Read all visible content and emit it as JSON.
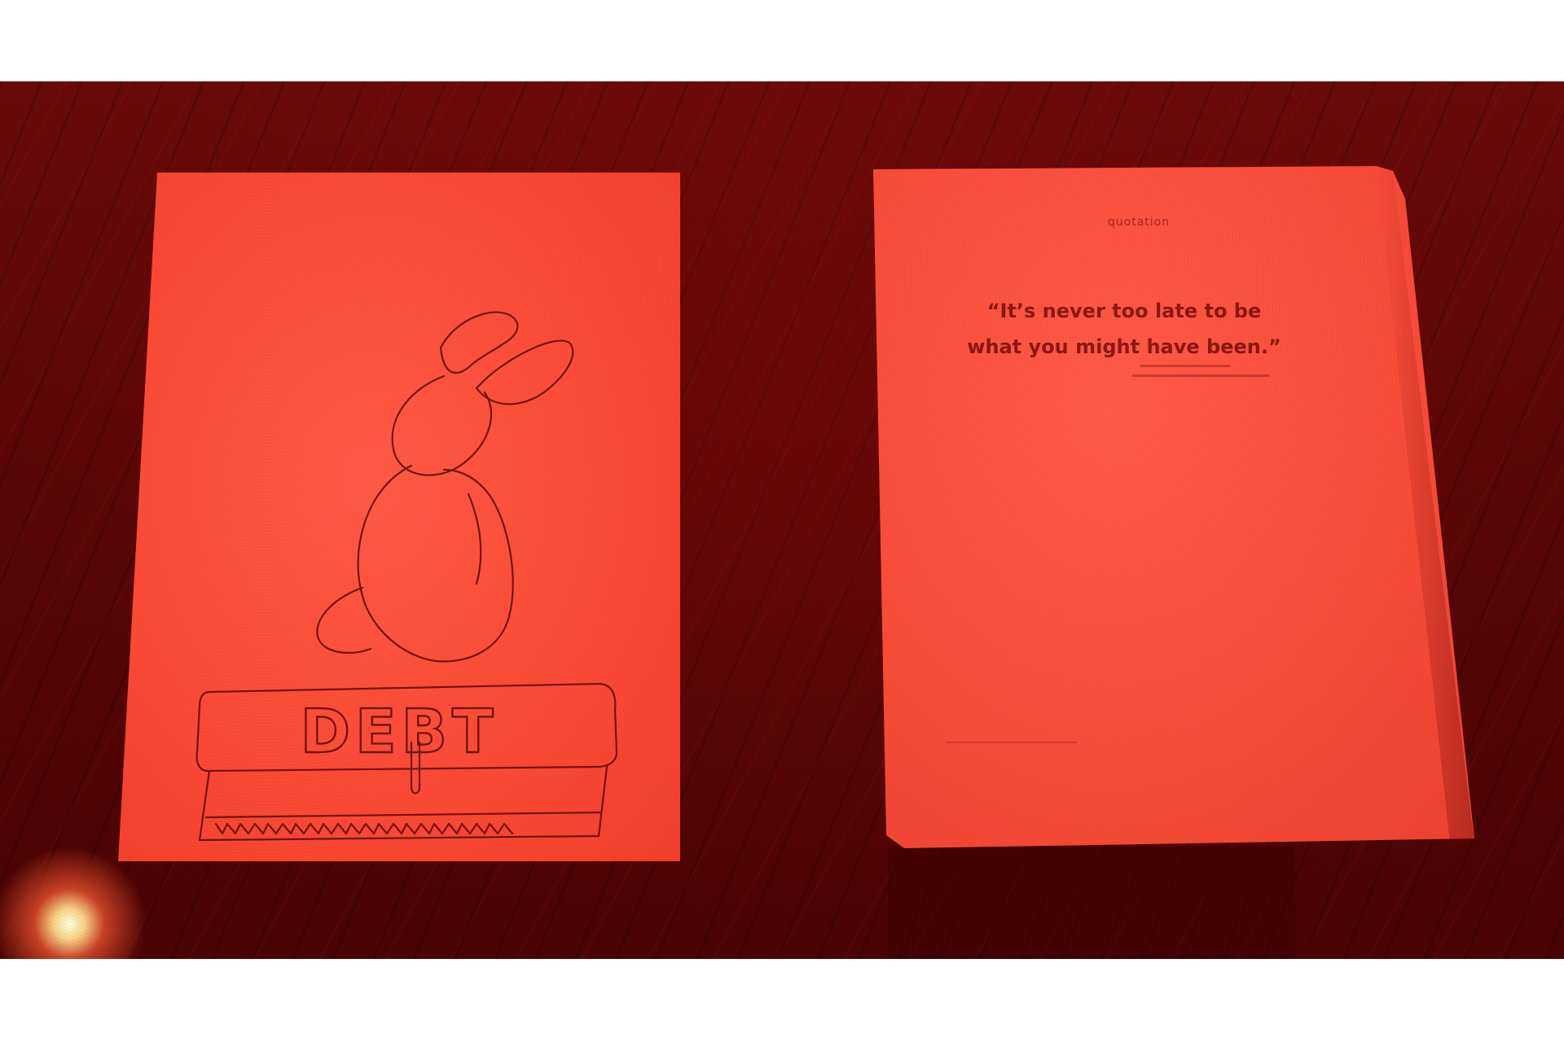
{
  "photo": {
    "left_sheet": {
      "drawing_text": "DEBT"
    },
    "right_book": {
      "header": "quotation",
      "quote_line1": "“It’s never too late to be",
      "quote_line2": "what you might have been.”"
    }
  }
}
